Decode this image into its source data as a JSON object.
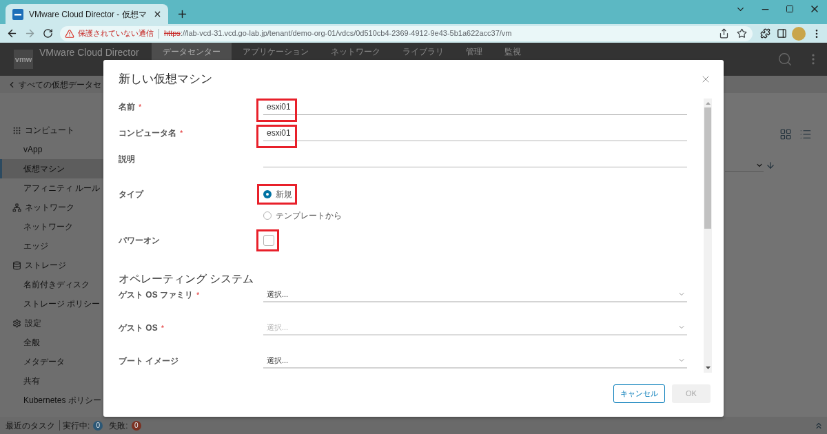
{
  "browser": {
    "tab": {
      "title": "VMware Cloud Director - 仮想マ"
    },
    "address_bar": {
      "secure": false,
      "warning": "保護されていない通信",
      "scheme": "https",
      "rest": "://lab-vcd-31.vcd.go-lab.jp/tenant/demo-org-01/vdcs/0d510cb4-2369-4912-9e43-5b1a622acc37/vm"
    }
  },
  "app": {
    "logo": "vmw",
    "title": "VMware Cloud Director",
    "nav": [
      {
        "label": "データセンター",
        "selected": true
      },
      {
        "label": "アプリケーション",
        "selected": false
      },
      {
        "label": "ネットワーク",
        "selected": false
      },
      {
        "label": "ライブラリ",
        "selected": false
      },
      {
        "label": "管理",
        "selected": false
      },
      {
        "label": "監視",
        "selected": false
      }
    ],
    "breadcrumb": "すべての仮想データセ"
  },
  "sidebar": {
    "children": [
      {
        "label": "コンピュート",
        "children": [
          {
            "label": "vApp",
            "selected": false
          },
          {
            "label": "仮想マシン",
            "selected": true
          },
          {
            "label": "アフィニティ ルール",
            "selected": false
          }
        ]
      },
      {
        "label": "ネットワーク",
        "children": [
          {
            "label": "ネットワーク",
            "selected": false
          },
          {
            "label": "エッジ",
            "selected": false
          }
        ]
      },
      {
        "label": "ストレージ",
        "children": [
          {
            "label": "名前付きディスク",
            "selected": false
          },
          {
            "label": "ストレージ ポリシー",
            "selected": false
          }
        ]
      },
      {
        "label": "設定",
        "children": [
          {
            "label": "全般",
            "selected": false
          },
          {
            "label": "メタデータ",
            "selected": false
          },
          {
            "label": "共有",
            "selected": false
          },
          {
            "label": "Kubernetes ポリシー",
            "selected": false
          }
        ]
      }
    ]
  },
  "dialog": {
    "title": "新しい仮想マシン",
    "fields": [
      {
        "kind": "text",
        "label": "名前",
        "required_mark": "*",
        "value": "esxi01",
        "highlighted": true
      },
      {
        "kind": "text",
        "label": "コンピュータ名",
        "required_mark": "*",
        "value": "esxi01",
        "highlighted": true
      },
      {
        "kind": "text",
        "label": "説明",
        "highlighted": false
      },
      {
        "kind": "radio",
        "label": "タイプ",
        "options": [
          {
            "label": "新規",
            "selected": true,
            "highlighted": true
          },
          {
            "label": "テンプレートから",
            "selected": false,
            "highlighted": false
          }
        ]
      },
      {
        "kind": "checkbox",
        "label": "パワーオン",
        "checked": false,
        "highlighted": true
      },
      {
        "kind": "heading",
        "label": "オペレーティング システム"
      },
      {
        "kind": "select",
        "label": "ゲスト OS ファミリ",
        "required_mark": "*",
        "placeholder": "選択...",
        "disabled": false
      },
      {
        "kind": "select",
        "label": "ゲスト OS",
        "required_mark": "*",
        "placeholder": "選択...",
        "disabled": true
      },
      {
        "kind": "select",
        "label": "ブート イメージ",
        "placeholder": "選択...",
        "disabled": false
      }
    ],
    "buttons": [
      {
        "label": "キャンセル",
        "kind": "outline",
        "disabled": false
      },
      {
        "label": "OK",
        "kind": "primary",
        "disabled": true
      }
    ]
  },
  "status_bar": {
    "label": "最近のタスク",
    "counters": [
      {
        "label": "実行中:",
        "count": "0",
        "color": "#2c5775"
      },
      {
        "label": "失敗:",
        "count": "0",
        "color": "#7b3122"
      }
    ]
  }
}
